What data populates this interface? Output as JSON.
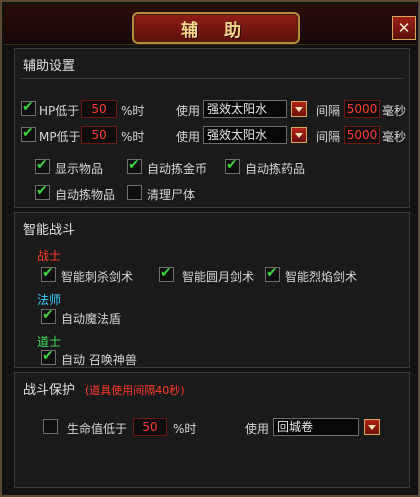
{
  "window": {
    "title": "辅 助",
    "close_label": "✕"
  },
  "assist_settings": {
    "title": "辅助设置",
    "hp_row": {
      "label": "HP低于",
      "value": "50",
      "unit": "%时",
      "use_label": "使用",
      "item": "强效太阳水",
      "interval_label": "间隔",
      "interval": "5000",
      "interval_unit": "毫秒",
      "checked": true
    },
    "mp_row": {
      "label": "MP低于",
      "value": "50",
      "unit": "%时",
      "use_label": "使用",
      "item": "强效太阳水",
      "interval_label": "间隔",
      "interval": "5000",
      "interval_unit": "毫秒",
      "checked": true
    },
    "options": [
      {
        "label": "显示物品",
        "checked": true
      },
      {
        "label": "自动拣金币",
        "checked": true
      },
      {
        "label": "自动拣药品",
        "checked": true
      },
      {
        "label": "自动拣物品",
        "checked": true
      },
      {
        "label": "清理尸体",
        "checked": false
      }
    ]
  },
  "smart_combat": {
    "title": "智能战斗",
    "warrior": {
      "label": "战士",
      "color": "#ff3a2c",
      "skills": [
        {
          "label": "智能刺杀剑术",
          "checked": true
        },
        {
          "label": "智能圆月剑术",
          "checked": true
        },
        {
          "label": "智能烈焰剑术",
          "checked": true
        }
      ]
    },
    "mage": {
      "label": "法师",
      "color": "#39d0ff",
      "skills": [
        {
          "label": "自动魔法盾",
          "checked": true
        }
      ]
    },
    "taoist": {
      "label": "道士",
      "color": "#3fe05a",
      "skills": [
        {
          "label": "自动 召唤神兽",
          "checked": true
        }
      ]
    }
  },
  "combat_protection": {
    "title": "战斗保护",
    "note": "(道具使用间隔40秒)",
    "life_label": "生命值低于",
    "life_value": "50",
    "life_unit": "%时",
    "use_label": "使用",
    "item": "回城卷",
    "checked": false
  }
}
